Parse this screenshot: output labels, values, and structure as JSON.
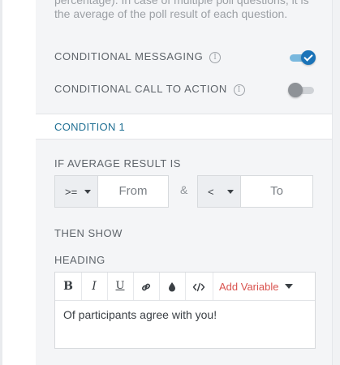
{
  "help_text": "percentage). In case of multiple poll questions, it is the average of the poll result of each question.",
  "toggles": [
    {
      "label": "CONDITIONAL MESSAGING",
      "state": "on"
    },
    {
      "label": "CONDITIONAL CALL TO ACTION",
      "state": "off"
    }
  ],
  "condition": {
    "header": "CONDITION 1",
    "if_label": "IF AVERAGE RESULT IS",
    "operator1": ">=",
    "from_placeholder": "From",
    "ampersand": "&",
    "operator2": "<",
    "to_placeholder": "To",
    "then_label": "THEN SHOW",
    "heading_label": "HEADING"
  },
  "editor": {
    "toolbar": {
      "bold": "B",
      "italic": "I",
      "underline": "U",
      "add_variable": "Add Variable"
    },
    "content": "Of participants agree with you!"
  },
  "colors": {
    "accent": "#1a73b8",
    "condition_header": "#1f6f93",
    "add_variable": "#d9534f"
  }
}
